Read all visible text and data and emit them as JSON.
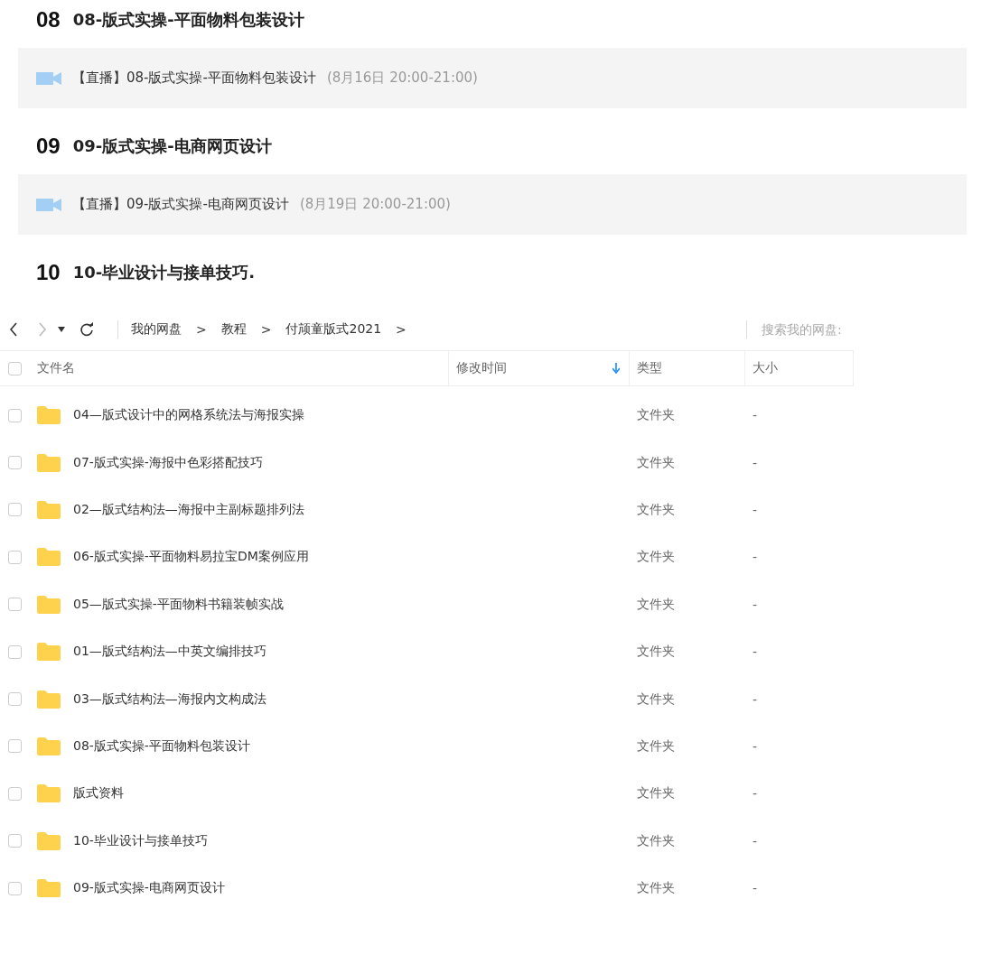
{
  "lessons": [
    {
      "number": "08",
      "title": "08-版式实操-平面物料包装设计",
      "live": {
        "label": "【直播】08-版式实操-平面物料包装设计",
        "time": "(8月16日 20:00-21:00)"
      }
    },
    {
      "number": "09",
      "title": "09-版式实操-电商网页设计",
      "live": {
        "label": "【直播】09-版式实操-电商网页设计",
        "time": "(8月19日 20:00-21:00)"
      }
    },
    {
      "number": "10",
      "title": "10-毕业设计与接单技巧."
    }
  ],
  "toolbar": {
    "breadcrumb": [
      "我的网盘",
      "教程",
      "付颃童版式2021"
    ],
    "separator": ">",
    "search": {
      "placeholder": "搜索我的网盘:"
    }
  },
  "select_all": {
    "checked": false
  },
  "columns": [
    {
      "label": "文件名"
    },
    {
      "label": "修改时间",
      "sorted": true
    },
    {
      "label": "类型"
    },
    {
      "label": "大小"
    }
  ],
  "files": [
    {
      "name": "04—版式设计中的网格系统法与海报实操",
      "type": "文件夹",
      "size": "-",
      "checked": false
    },
    {
      "name": "07-版式实操-海报中色彩搭配技巧",
      "type": "文件夹",
      "size": "-",
      "checked": false
    },
    {
      "name": "02—版式结构法—海报中主副标题排列法",
      "type": "文件夹",
      "size": "-",
      "checked": false
    },
    {
      "name": "06-版式实操-平面物料易拉宝DM案例应用",
      "type": "文件夹",
      "size": "-",
      "checked": false
    },
    {
      "name": "05—版式实操-平面物料书籍装帧实战",
      "type": "文件夹",
      "size": "-",
      "checked": false
    },
    {
      "name": "01—版式结构法—中英文编排技巧",
      "type": "文件夹",
      "size": "-",
      "checked": false
    },
    {
      "name": "03—版式结构法—海报内文构成法",
      "type": "文件夹",
      "size": "-",
      "checked": false
    },
    {
      "name": "08-版式实操-平面物料包装设计",
      "type": "文件夹",
      "size": "-",
      "checked": false
    },
    {
      "name": "版式资料",
      "type": "文件夹",
      "size": "-",
      "checked": false
    },
    {
      "name": "10-毕业设计与接单技巧",
      "type": "文件夹",
      "size": "-",
      "checked": false
    },
    {
      "name": "09-版式实操-电商网页设计",
      "type": "文件夹",
      "size": "-",
      "checked": false
    }
  ]
}
